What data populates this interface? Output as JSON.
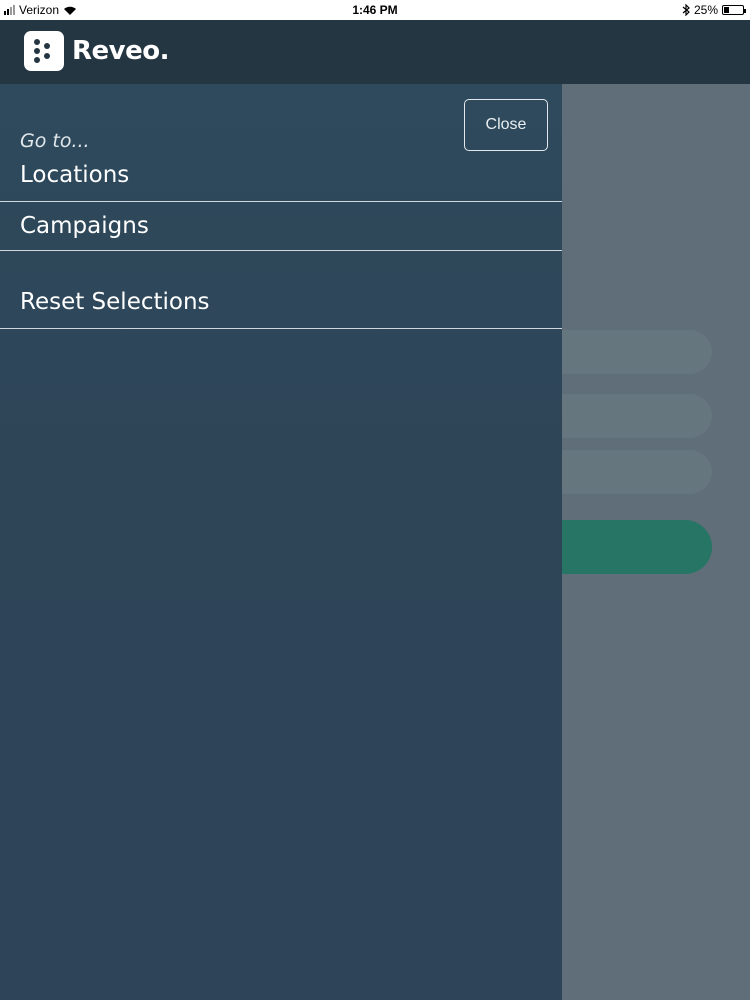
{
  "status_bar": {
    "carrier": "Verizon",
    "time": "1:46 PM",
    "battery": "25%",
    "battery_level": 0.25,
    "icons": [
      "signal-icon",
      "wifi-icon",
      "bluetooth-icon",
      "battery-icon"
    ]
  },
  "app_bar": {
    "logo_text": "Reveo."
  },
  "drawer": {
    "close_label": "Close",
    "goto_label": "Go to...",
    "items": [
      {
        "label": "Locations"
      },
      {
        "label": "Campaigns"
      },
      {
        "label": "Reset Selections"
      }
    ]
  },
  "colors": {
    "app_bar": "#253643",
    "drawer": "#2e4558",
    "overlay": "#5f6e78",
    "accent_button": "#267565"
  }
}
